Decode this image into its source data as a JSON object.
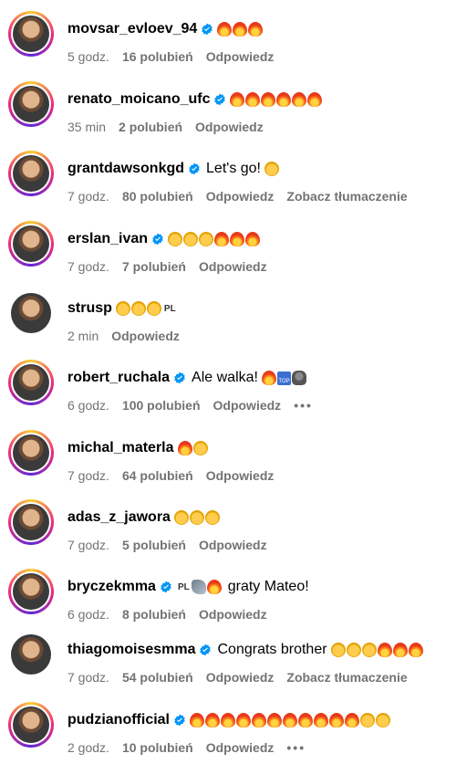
{
  "comments": [
    {
      "username": "movsar_evloev_94",
      "verified": true,
      "text": "",
      "emojis": [
        "fire",
        "fire",
        "fire"
      ],
      "time": "5 godz.",
      "likes": "16 polubień",
      "reply": "Odpowiedz",
      "translate": "",
      "more": false,
      "ring": true
    },
    {
      "username": "renato_moicano_ufc",
      "verified": true,
      "text": "",
      "emojis": [
        "fire",
        "fire",
        "fire",
        "fire",
        "fire",
        "fire"
      ],
      "time": "35 min",
      "likes": "2 polubień",
      "reply": "Odpowiedz",
      "translate": "",
      "more": false,
      "ring": true
    },
    {
      "username": "grantdawsonkgd",
      "verified": true,
      "text": "Let's go!",
      "emojis": [
        "clap"
      ],
      "time": "7 godz.",
      "likes": "80 polubień",
      "reply": "Odpowiedz",
      "translate": "Zobacz tłumaczenie",
      "more": false,
      "ring": true
    },
    {
      "username": "erslan_ivan",
      "verified": true,
      "text": "",
      "emojis": [
        "clap",
        "clap",
        "clap",
        "fire",
        "fire",
        "fire"
      ],
      "time": "7 godz.",
      "likes": "7 polubień",
      "reply": "Odpowiedz",
      "translate": "",
      "more": false,
      "ring": true
    },
    {
      "username": "strusp",
      "verified": false,
      "text": "",
      "emojis": [
        "clap",
        "clap",
        "clap",
        "pl"
      ],
      "time": "2 min",
      "likes": "",
      "reply": "Odpowiedz",
      "translate": "",
      "more": false,
      "ring": false
    },
    {
      "username": "robert_ruchala",
      "verified": true,
      "text": "Ale walka!",
      "emojis": [
        "fire",
        "top",
        "gorilla"
      ],
      "time": "6 godz.",
      "likes": "100 polubień",
      "reply": "Odpowiedz",
      "translate": "",
      "more": true,
      "ring": true
    },
    {
      "username": "michal_materla",
      "verified": false,
      "text": "",
      "emojis": [
        "fire",
        "clap"
      ],
      "time": "7 godz.",
      "likes": "64 polubień",
      "reply": "Odpowiedz",
      "translate": "",
      "more": false,
      "ring": true
    },
    {
      "username": "adas_z_jawora",
      "verified": false,
      "text": "",
      "emojis": [
        "clap",
        "clap",
        "clap"
      ],
      "time": "7 godz.",
      "likes": "5 polubień",
      "reply": "Odpowiedz",
      "translate": "",
      "more": false,
      "ring": true
    },
    {
      "username": "bryczekmma",
      "verified": true,
      "text": "graty Mateo!",
      "emojis": [
        "pl",
        "muscle",
        "fire"
      ],
      "emojis_before_text": true,
      "time": "6 godz.",
      "likes": "8 polubień",
      "reply": "Odpowiedz",
      "translate": "",
      "more": false,
      "ring": true
    },
    {
      "username": "thiagomoisesmma",
      "verified": true,
      "text": "Congrats brother",
      "emojis": [
        "clap",
        "clap",
        "clap",
        "fire",
        "fire",
        "fire"
      ],
      "time": "7 godz.",
      "likes": "54 polubień",
      "reply": "Odpowiedz",
      "translate": "Zobacz tłumaczenie",
      "more": false,
      "ring": false
    },
    {
      "username": "pudzianofficial",
      "verified": true,
      "text": "",
      "emojis": [
        "fire",
        "fire",
        "fire",
        "fire",
        "fire",
        "fire",
        "fire",
        "fire",
        "fire",
        "fire",
        "fire",
        "clap",
        "clap"
      ],
      "time": "2 godz.",
      "likes": "10 polubień",
      "reply": "Odpowiedz",
      "translate": "",
      "more": true,
      "ring": true
    }
  ],
  "more_label": "•••",
  "colors": {
    "meta": "#737373",
    "verified": "#0095f6"
  }
}
